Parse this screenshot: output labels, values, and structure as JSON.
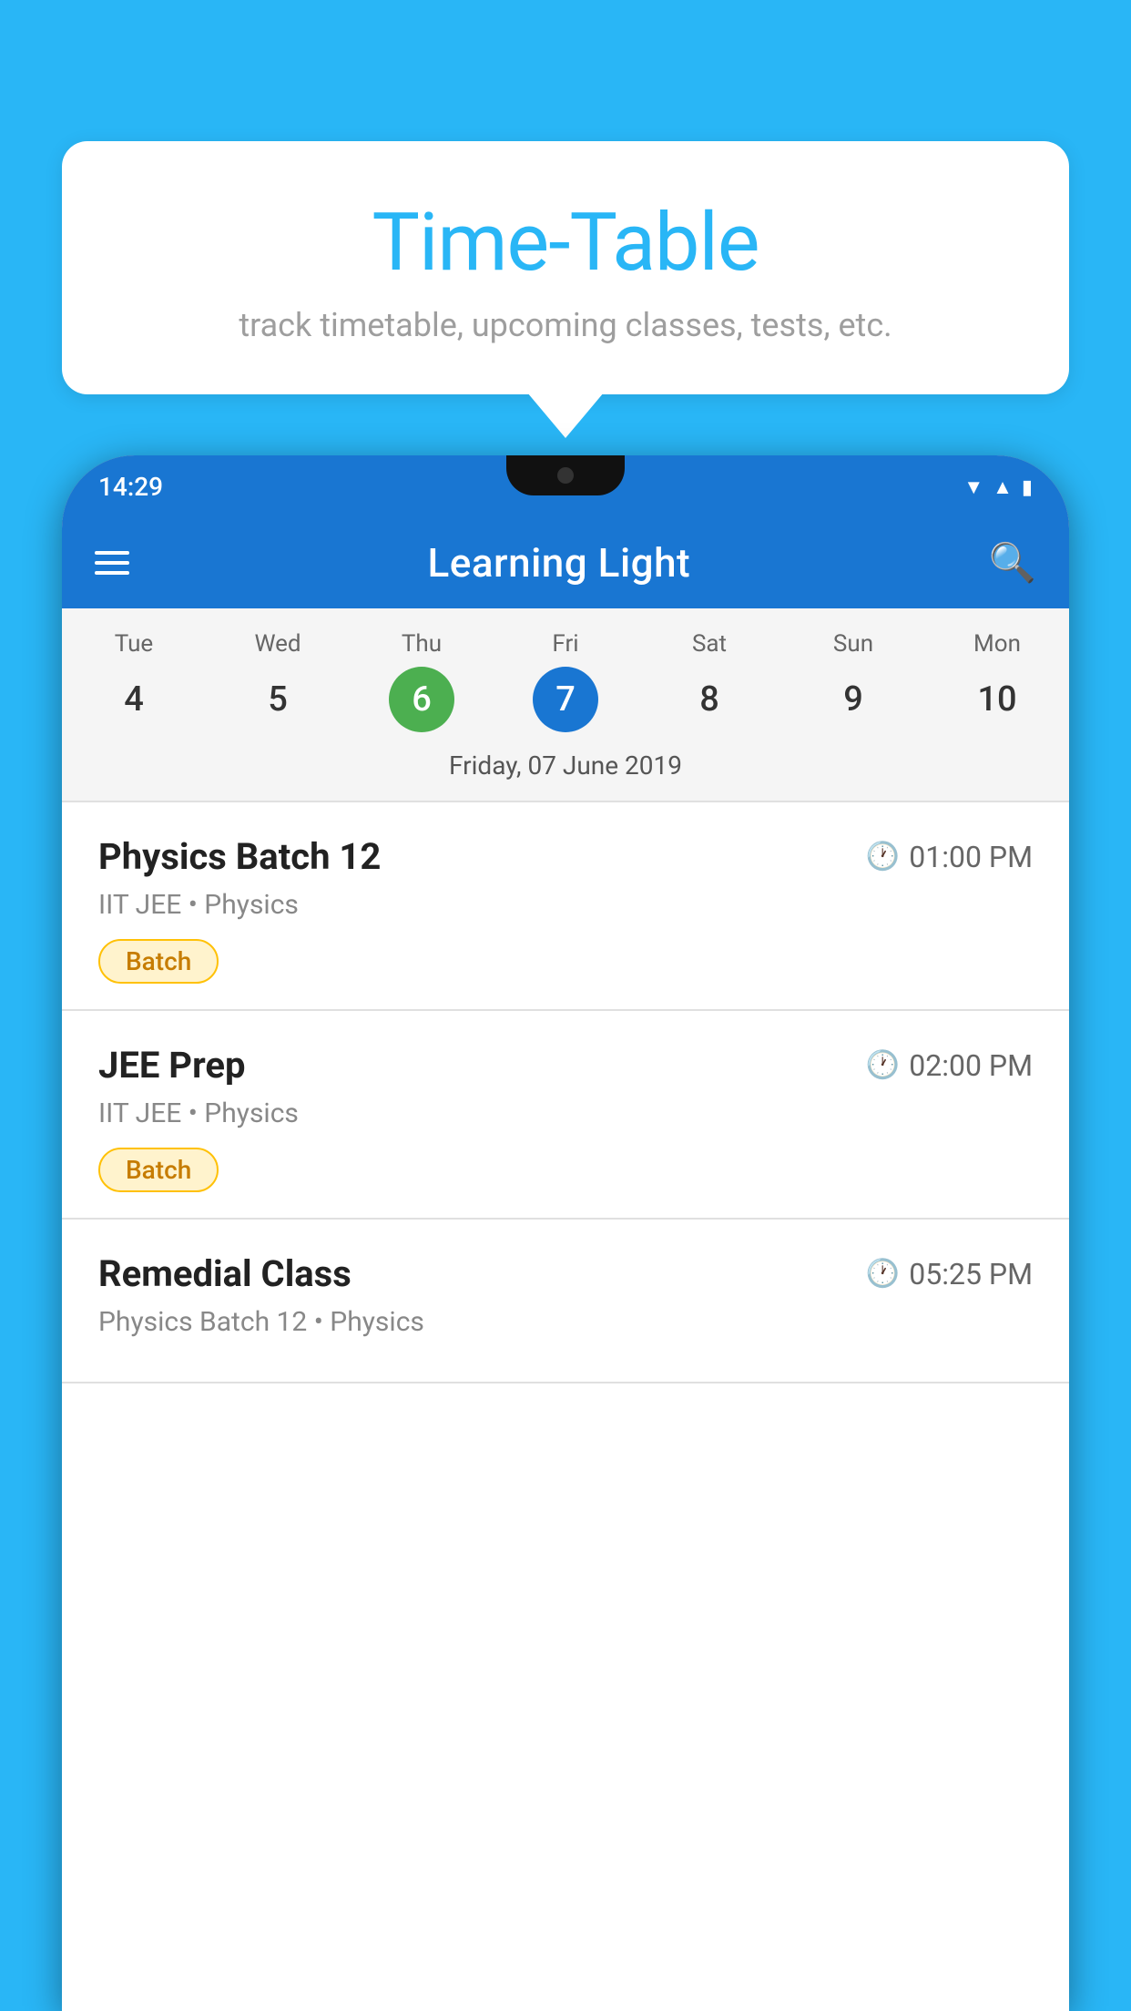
{
  "background_color": "#29b6f6",
  "tooltip": {
    "title": "Time-Table",
    "subtitle": "track timetable, upcoming classes, tests, etc."
  },
  "phone": {
    "status_bar": {
      "time": "14:29"
    },
    "app_header": {
      "title": "Learning Light"
    },
    "calendar": {
      "days": [
        {
          "name": "Tue",
          "number": "4",
          "state": "normal"
        },
        {
          "name": "Wed",
          "number": "5",
          "state": "normal"
        },
        {
          "name": "Thu",
          "number": "6",
          "state": "today"
        },
        {
          "name": "Fri",
          "number": "7",
          "state": "selected"
        },
        {
          "name": "Sat",
          "number": "8",
          "state": "normal"
        },
        {
          "name": "Sun",
          "number": "9",
          "state": "normal"
        },
        {
          "name": "Mon",
          "number": "10",
          "state": "normal"
        }
      ],
      "selected_date_label": "Friday, 07 June 2019"
    },
    "schedule": [
      {
        "title": "Physics Batch 12",
        "time": "01:00 PM",
        "subtitle": "IIT JEE • Physics",
        "badge": "Batch"
      },
      {
        "title": "JEE Prep",
        "time": "02:00 PM",
        "subtitle": "IIT JEE • Physics",
        "badge": "Batch"
      },
      {
        "title": "Remedial Class",
        "time": "05:25 PM",
        "subtitle": "Physics Batch 12 • Physics",
        "badge": null
      }
    ]
  }
}
